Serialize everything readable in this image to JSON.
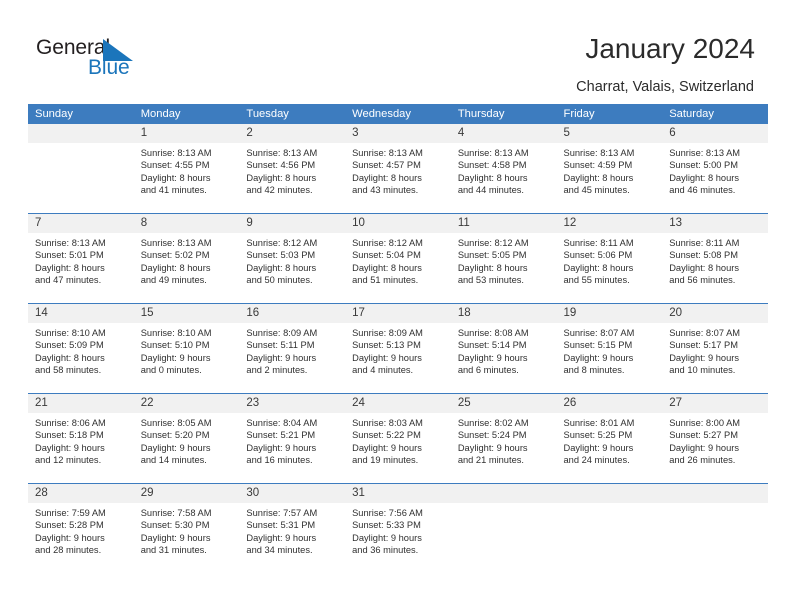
{
  "brand": {
    "name_top": "General",
    "name_bottom": "Blue",
    "accent_color": "#1b75bb"
  },
  "header": {
    "title": "January 2024",
    "location": "Charrat, Valais, Switzerland"
  },
  "theme": {
    "header_blue": "#3d7cbf",
    "day_band_gray": "#f1f1f1",
    "text_color": "#303030"
  },
  "weekday_headers": [
    "Sunday",
    "Monday",
    "Tuesday",
    "Wednesday",
    "Thursday",
    "Friday",
    "Saturday"
  ],
  "weeks": [
    [
      {
        "day": "",
        "sunrise": "",
        "sunset": "",
        "daylight_1": "",
        "daylight_2": ""
      },
      {
        "day": "1",
        "sunrise": "Sunrise: 8:13 AM",
        "sunset": "Sunset: 4:55 PM",
        "daylight_1": "Daylight: 8 hours",
        "daylight_2": "and 41 minutes."
      },
      {
        "day": "2",
        "sunrise": "Sunrise: 8:13 AM",
        "sunset": "Sunset: 4:56 PM",
        "daylight_1": "Daylight: 8 hours",
        "daylight_2": "and 42 minutes."
      },
      {
        "day": "3",
        "sunrise": "Sunrise: 8:13 AM",
        "sunset": "Sunset: 4:57 PM",
        "daylight_1": "Daylight: 8 hours",
        "daylight_2": "and 43 minutes."
      },
      {
        "day": "4",
        "sunrise": "Sunrise: 8:13 AM",
        "sunset": "Sunset: 4:58 PM",
        "daylight_1": "Daylight: 8 hours",
        "daylight_2": "and 44 minutes."
      },
      {
        "day": "5",
        "sunrise": "Sunrise: 8:13 AM",
        "sunset": "Sunset: 4:59 PM",
        "daylight_1": "Daylight: 8 hours",
        "daylight_2": "and 45 minutes."
      },
      {
        "day": "6",
        "sunrise": "Sunrise: 8:13 AM",
        "sunset": "Sunset: 5:00 PM",
        "daylight_1": "Daylight: 8 hours",
        "daylight_2": "and 46 minutes."
      }
    ],
    [
      {
        "day": "7",
        "sunrise": "Sunrise: 8:13 AM",
        "sunset": "Sunset: 5:01 PM",
        "daylight_1": "Daylight: 8 hours",
        "daylight_2": "and 47 minutes."
      },
      {
        "day": "8",
        "sunrise": "Sunrise: 8:13 AM",
        "sunset": "Sunset: 5:02 PM",
        "daylight_1": "Daylight: 8 hours",
        "daylight_2": "and 49 minutes."
      },
      {
        "day": "9",
        "sunrise": "Sunrise: 8:12 AM",
        "sunset": "Sunset: 5:03 PM",
        "daylight_1": "Daylight: 8 hours",
        "daylight_2": "and 50 minutes."
      },
      {
        "day": "10",
        "sunrise": "Sunrise: 8:12 AM",
        "sunset": "Sunset: 5:04 PM",
        "daylight_1": "Daylight: 8 hours",
        "daylight_2": "and 51 minutes."
      },
      {
        "day": "11",
        "sunrise": "Sunrise: 8:12 AM",
        "sunset": "Sunset: 5:05 PM",
        "daylight_1": "Daylight: 8 hours",
        "daylight_2": "and 53 minutes."
      },
      {
        "day": "12",
        "sunrise": "Sunrise: 8:11 AM",
        "sunset": "Sunset: 5:06 PM",
        "daylight_1": "Daylight: 8 hours",
        "daylight_2": "and 55 minutes."
      },
      {
        "day": "13",
        "sunrise": "Sunrise: 8:11 AM",
        "sunset": "Sunset: 5:08 PM",
        "daylight_1": "Daylight: 8 hours",
        "daylight_2": "and 56 minutes."
      }
    ],
    [
      {
        "day": "14",
        "sunrise": "Sunrise: 8:10 AM",
        "sunset": "Sunset: 5:09 PM",
        "daylight_1": "Daylight: 8 hours",
        "daylight_2": "and 58 minutes."
      },
      {
        "day": "15",
        "sunrise": "Sunrise: 8:10 AM",
        "sunset": "Sunset: 5:10 PM",
        "daylight_1": "Daylight: 9 hours",
        "daylight_2": "and 0 minutes."
      },
      {
        "day": "16",
        "sunrise": "Sunrise: 8:09 AM",
        "sunset": "Sunset: 5:11 PM",
        "daylight_1": "Daylight: 9 hours",
        "daylight_2": "and 2 minutes."
      },
      {
        "day": "17",
        "sunrise": "Sunrise: 8:09 AM",
        "sunset": "Sunset: 5:13 PM",
        "daylight_1": "Daylight: 9 hours",
        "daylight_2": "and 4 minutes."
      },
      {
        "day": "18",
        "sunrise": "Sunrise: 8:08 AM",
        "sunset": "Sunset: 5:14 PM",
        "daylight_1": "Daylight: 9 hours",
        "daylight_2": "and 6 minutes."
      },
      {
        "day": "19",
        "sunrise": "Sunrise: 8:07 AM",
        "sunset": "Sunset: 5:15 PM",
        "daylight_1": "Daylight: 9 hours",
        "daylight_2": "and 8 minutes."
      },
      {
        "day": "20",
        "sunrise": "Sunrise: 8:07 AM",
        "sunset": "Sunset: 5:17 PM",
        "daylight_1": "Daylight: 9 hours",
        "daylight_2": "and 10 minutes."
      }
    ],
    [
      {
        "day": "21",
        "sunrise": "Sunrise: 8:06 AM",
        "sunset": "Sunset: 5:18 PM",
        "daylight_1": "Daylight: 9 hours",
        "daylight_2": "and 12 minutes."
      },
      {
        "day": "22",
        "sunrise": "Sunrise: 8:05 AM",
        "sunset": "Sunset: 5:20 PM",
        "daylight_1": "Daylight: 9 hours",
        "daylight_2": "and 14 minutes."
      },
      {
        "day": "23",
        "sunrise": "Sunrise: 8:04 AM",
        "sunset": "Sunset: 5:21 PM",
        "daylight_1": "Daylight: 9 hours",
        "daylight_2": "and 16 minutes."
      },
      {
        "day": "24",
        "sunrise": "Sunrise: 8:03 AM",
        "sunset": "Sunset: 5:22 PM",
        "daylight_1": "Daylight: 9 hours",
        "daylight_2": "and 19 minutes."
      },
      {
        "day": "25",
        "sunrise": "Sunrise: 8:02 AM",
        "sunset": "Sunset: 5:24 PM",
        "daylight_1": "Daylight: 9 hours",
        "daylight_2": "and 21 minutes."
      },
      {
        "day": "26",
        "sunrise": "Sunrise: 8:01 AM",
        "sunset": "Sunset: 5:25 PM",
        "daylight_1": "Daylight: 9 hours",
        "daylight_2": "and 24 minutes."
      },
      {
        "day": "27",
        "sunrise": "Sunrise: 8:00 AM",
        "sunset": "Sunset: 5:27 PM",
        "daylight_1": "Daylight: 9 hours",
        "daylight_2": "and 26 minutes."
      }
    ],
    [
      {
        "day": "28",
        "sunrise": "Sunrise: 7:59 AM",
        "sunset": "Sunset: 5:28 PM",
        "daylight_1": "Daylight: 9 hours",
        "daylight_2": "and 28 minutes."
      },
      {
        "day": "29",
        "sunrise": "Sunrise: 7:58 AM",
        "sunset": "Sunset: 5:30 PM",
        "daylight_1": "Daylight: 9 hours",
        "daylight_2": "and 31 minutes."
      },
      {
        "day": "30",
        "sunrise": "Sunrise: 7:57 AM",
        "sunset": "Sunset: 5:31 PM",
        "daylight_1": "Daylight: 9 hours",
        "daylight_2": "and 34 minutes."
      },
      {
        "day": "31",
        "sunrise": "Sunrise: 7:56 AM",
        "sunset": "Sunset: 5:33 PM",
        "daylight_1": "Daylight: 9 hours",
        "daylight_2": "and 36 minutes."
      },
      {
        "day": "",
        "sunrise": "",
        "sunset": "",
        "daylight_1": "",
        "daylight_2": ""
      },
      {
        "day": "",
        "sunrise": "",
        "sunset": "",
        "daylight_1": "",
        "daylight_2": ""
      },
      {
        "day": "",
        "sunrise": "",
        "sunset": "",
        "daylight_1": "",
        "daylight_2": ""
      }
    ]
  ]
}
